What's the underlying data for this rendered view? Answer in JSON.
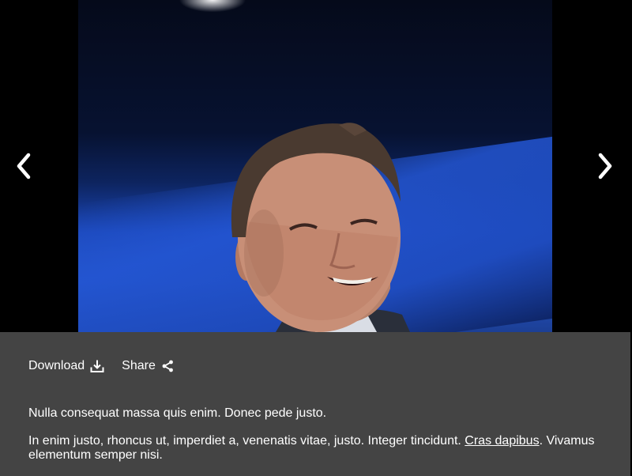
{
  "viewer": {
    "prev_icon": "chevron-left-icon",
    "next_icon": "chevron-right-icon"
  },
  "actions": {
    "download_label": "Download",
    "download_icon": "download-icon",
    "share_label": "Share",
    "share_icon": "share-icon"
  },
  "caption": {
    "line1": "Nulla consequat massa quis enim. Donec pede justo.",
    "line2_before": "In enim justo, rhoncus ut, imperdiet a, venenatis vitae, justo. Integer tincidunt. ",
    "line2_link": "Cras dapibus",
    "line2_after": ". Vivamus elementum semper nisi."
  },
  "colors": {
    "panel_bg": "#444444",
    "text": "#ffffff",
    "viewer_bg": "#000000"
  }
}
